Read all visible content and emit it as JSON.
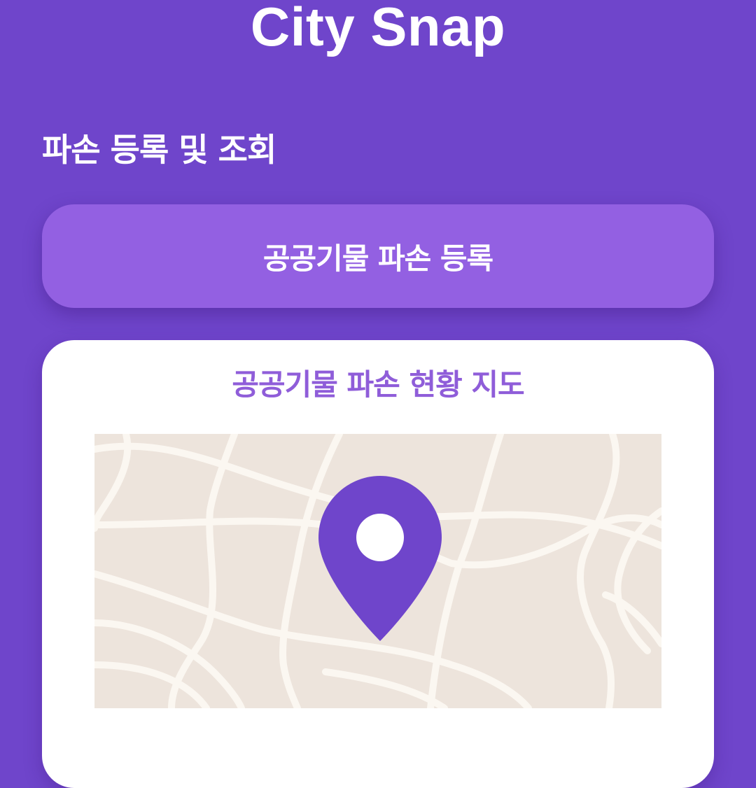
{
  "header": {
    "app_title": "City Snap"
  },
  "main": {
    "section_heading": "파손 등록 및 조회",
    "register_button_label": "공공기물 파손 등록",
    "map_card": {
      "title": "공공기물 파손 현황 지도",
      "map_icon": "map-icon",
      "pin_icon": "location-pin-icon"
    }
  },
  "colors": {
    "background": "#6f45cb",
    "button": "#9360e2",
    "card": "#ffffff",
    "card_title": "#8f5dd9",
    "map_land": "#ede4dc",
    "map_road": "#fbf7f1",
    "pin": "#6f45cb"
  }
}
